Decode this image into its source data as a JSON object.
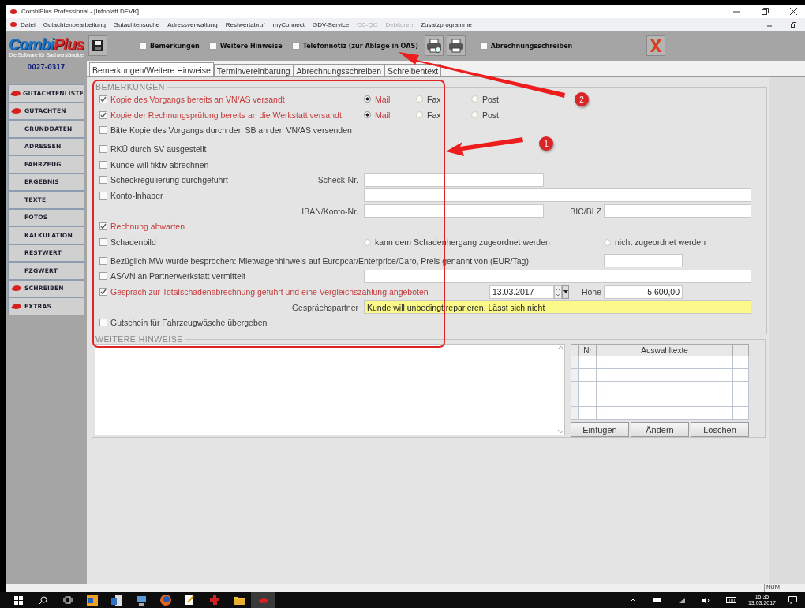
{
  "window": {
    "title": "CombiPlus Professional - [Infoblatt DEVK]"
  },
  "menu": [
    {
      "label": "Datei",
      "disabled": false
    },
    {
      "label": "Gutachtenbearbeitung",
      "disabled": false
    },
    {
      "label": "Gutachtensuche",
      "disabled": false
    },
    {
      "label": "Adressverwaltung",
      "disabled": false
    },
    {
      "label": "Restwertabruf",
      "disabled": false
    },
    {
      "label": "myConnect",
      "disabled": false
    },
    {
      "label": "GDV-Service",
      "disabled": false
    },
    {
      "label": "CC-QC",
      "disabled": true
    },
    {
      "label": "Debitoren",
      "disabled": true
    },
    {
      "label": "Zusatzprogramme",
      "disabled": false
    }
  ],
  "toolbar": {
    "logo_main": "Combi",
    "logo_accent": "Plus",
    "logo_tagline": "Die Software für Sachverständige",
    "checks": [
      {
        "label": "Bemerkungen",
        "checked": false
      },
      {
        "label": "Weitere Hinweise",
        "checked": false
      },
      {
        "label": "Telefonnotiz (zur Ablage in OAS)",
        "checked": false
      }
    ],
    "checks_after_print": [
      {
        "label": "Abrechnungsschreiben",
        "checked": false
      }
    ]
  },
  "sidebar": {
    "case_number": "0027-0317",
    "items": [
      {
        "label": "GUTACHTENLISTE",
        "has_icon": true
      },
      {
        "label": "GUTACHTEN",
        "has_icon": true
      },
      {
        "label": "GRUNDDATEN",
        "has_icon": false
      },
      {
        "label": "ADRESSEN",
        "has_icon": false
      },
      {
        "label": "FAHRZEUG",
        "has_icon": false
      },
      {
        "label": "ERGEBNIS",
        "has_icon": false
      },
      {
        "label": "TEXTE",
        "has_icon": false
      },
      {
        "label": "FOTOS",
        "has_icon": false
      },
      {
        "label": "KALKULATION",
        "has_icon": false
      },
      {
        "label": "RESTWERT",
        "has_icon": false
      },
      {
        "label": "FZGWERT",
        "has_icon": false
      },
      {
        "label": "SCHREIBEN",
        "has_icon": true
      },
      {
        "label": "EXTRAS",
        "has_icon": true
      }
    ]
  },
  "tabs": [
    {
      "label": "Bemerkungen/Weitere Hinweise",
      "selected": true
    },
    {
      "label": "Terminvereinbarung",
      "selected": false
    },
    {
      "label": "Abrechnungsschreiben",
      "selected": false
    },
    {
      "label": "Schreibentext",
      "selected": false
    }
  ],
  "bemerkungen": {
    "title": "BEMERKUNGEN",
    "groups": [
      [
        {
          "kind": "radios",
          "label": "Kopie des Vorgangs bereits an VN/AS versandt",
          "checked": true,
          "options": [
            {
              "label": "Mail",
              "selected": true
            },
            {
              "label": "Fax",
              "selected": false
            },
            {
              "label": "Post",
              "selected": false
            }
          ]
        },
        {
          "kind": "radios",
          "label": "Kopie der Rechnungsprüfung bereits an die Werkstatt versandt",
          "checked": true,
          "options": [
            {
              "label": "Mail",
              "selected": true
            },
            {
              "label": "Fax",
              "selected": false
            },
            {
              "label": "Post",
              "selected": false
            }
          ]
        },
        {
          "kind": "check",
          "label": "Bitte Kopie des Vorgangs durch den SB an den VN/AS versenden",
          "checked": false
        }
      ],
      [
        {
          "kind": "check",
          "label": "RKÜ durch SV ausgestellt",
          "checked": false
        },
        {
          "kind": "check",
          "label": "Kunde will fiktiv abrechnen",
          "checked": false
        },
        {
          "kind": "check_field",
          "label": "Scheckregulierung durchgeführt",
          "checked": false,
          "field_label": "Scheck-Nr."
        },
        {
          "kind": "check_wide_field",
          "label": "Konto-Inhaber",
          "checked": false
        },
        {
          "kind": "iban",
          "field_label": "IBAN/Konto-Nr.",
          "second_label": "BIC/BLZ"
        },
        {
          "kind": "check",
          "label": "Rechnung abwarten",
          "checked": true
        },
        {
          "kind": "choice",
          "label": "Schadenbild",
          "checked": false,
          "options": [
            {
              "label": "kann dem Schadenhergang zugeordnet werden",
              "selected": false
            },
            {
              "label": "nicht zugeordnet werden",
              "selected": false
            }
          ]
        }
      ],
      [
        {
          "kind": "price",
          "label": "Bezüglich MW wurde besprochen: Mietwagenhinweis auf Europcar/Enterprice/Caro, Preis genannt von (EUR/Tag)",
          "checked": false
        },
        {
          "kind": "check_wide_field",
          "label": "AS/VN an Partnerwerkstatt vermittelt",
          "checked": false
        },
        {
          "kind": "settlement",
          "label": "Gespräch zur Totalschadenabrechnung geführt und eine Vergleichszahlung angeboten",
          "checked": true,
          "date": "13.03.2017",
          "amount_label": "Höhe",
          "amount": "5.600,00"
        },
        {
          "kind": "partner",
          "field_label": "Gesprächspartner",
          "value": "Kunde will unbedingt reparieren. Lässt sich nicht"
        },
        {
          "kind": "check",
          "label": "Gutschein für Fahrzeugwäsche übergeben",
          "checked": false
        }
      ]
    ]
  },
  "weitere_hinweise": {
    "title": "WEITERE HINWEISE",
    "table": {
      "columns": [
        "Nr",
        "Auswahltexte"
      ]
    },
    "buttons": [
      "Einfügen",
      "Ändern",
      "Löschen"
    ]
  },
  "status_bar": {
    "indicator": "NUM"
  },
  "taskbar": {
    "time": "15:35",
    "date": "13.03.2017"
  },
  "annotations": [
    {
      "label": "1"
    },
    {
      "label": "2"
    }
  ]
}
